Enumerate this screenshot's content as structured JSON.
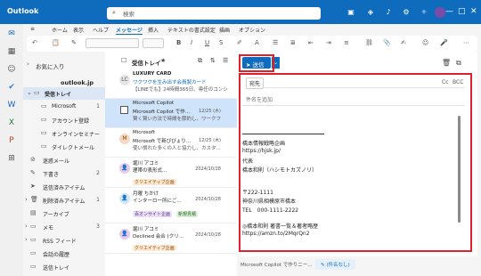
{
  "titlebar": {
    "app_title": "Outlook",
    "search_placeholder": "検索"
  },
  "ribbon_tabs": [
    "ホーム",
    "表示",
    "ヘルプ",
    "メッセージ",
    "挿入",
    "テキストの書式設定",
    "描画",
    "オプション"
  ],
  "ribbon_active_tab": "メッセージ",
  "folders": {
    "favorites": "お気に入り",
    "account": "outlook.jp",
    "items": [
      {
        "label": "受信トレイ",
        "count": ""
      },
      {
        "label": "Microsoft",
        "count": "1"
      },
      {
        "label": "アカウント登録",
        "count": ""
      },
      {
        "label": "オンラインセミナー",
        "count": ""
      },
      {
        "label": "ダイレクトメール",
        "count": ""
      },
      {
        "label": "迷惑メール",
        "count": ""
      },
      {
        "label": "下書き",
        "count": "2"
      },
      {
        "label": "送信済みアイテム",
        "count": ""
      },
      {
        "label": "削除済みアイテム",
        "count": "1"
      },
      {
        "label": "アーカイブ",
        "count": ""
      },
      {
        "label": "メモ",
        "count": "3"
      },
      {
        "label": "RSS フィード",
        "count": ""
      },
      {
        "label": "会話の履歴",
        "count": ""
      },
      {
        "label": "送信トレイ",
        "count": ""
      }
    ]
  },
  "message_list": {
    "title": "受信トレイ",
    "messages": [
      {
        "avatar": "LC",
        "sender": "LUXURY CARD",
        "subject": "ワクワクを生み出す会員製カード",
        "preview": "【LINEでも】24時間365日、専任のコンシ",
        "date": ""
      },
      {
        "avatar": "",
        "sender": "Microsoft Copilot",
        "subject": "Microsoft Copilot で作...",
        "preview": "賢く賢い方法で時間を節約し、ワークフ",
        "date": "12/25 (木)"
      },
      {
        "avatar": "M",
        "sender": "Microsoft",
        "subject": "Microsoft で新びびょり…",
        "preview": "使い慣れた多くの人と協力し、カスタ...",
        "date": "12/25 (木)"
      },
      {
        "avatar": "",
        "sender": "堀川 アコミ",
        "subject": "理帯の表形式…",
        "preview": "クリエイティブ企画 一橋本 雄行と...",
        "date": "2024/10/28",
        "tag": "クリエイティブ企画"
      },
      {
        "avatar": "",
        "sender": "月曜 ちかけ",
        "subject": "インターロー所にご…",
        "preview": "百オンサイト企画 新規見積",
        "date": "2024/10/28",
        "tag": "百オンサイト企画",
        "tag2": "新規見積"
      },
      {
        "avatar": "",
        "sender": "堀川 アコミ",
        "subject": "Declined 会合 (クリ…",
        "preview": "クリエイティブ企画",
        "date": "2024/10/28",
        "tag": "クリエイティブ企画"
      }
    ]
  },
  "composer": {
    "send_label": "送信",
    "to_label": "宛先",
    "cc_label": "Cc",
    "bcc_label": "BCC",
    "subject_placeholder": "件名を追加",
    "signature_lines": [
      "橋本情報戦略企画",
      "https://hjsk.jp/",
      "代表",
      "橋本和則（ハシモトカズノリ）",
      "〒222-1111",
      "神奈川県相模原市橋本",
      "TEL　000-1111-2222",
      "◎橋本和則 著書一覧＆著者略歴",
      "https://amzn.to/2MqrQn2"
    ]
  },
  "bottom_tabs": {
    "draft_tab": "Microsoft Copilot で作りニー...",
    "new_tab": "(件名なし)"
  }
}
